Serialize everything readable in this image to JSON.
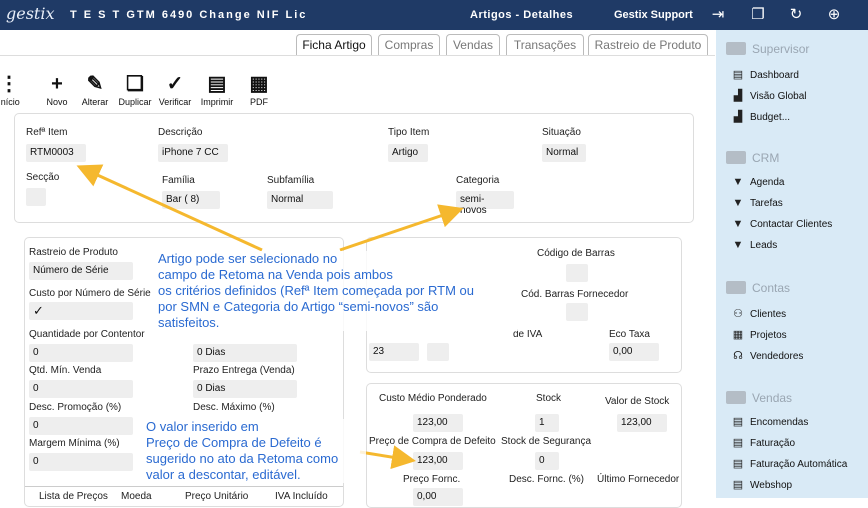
{
  "topbar": {
    "logo": "gestix",
    "app_title": "T E S T GTM 6490 Change NIF Lic",
    "page_title": "Artigos - Detalhes",
    "user": "Gestix Support",
    "icons": [
      "exit-icon",
      "windows-icon",
      "refresh-icon",
      "lifebuoy-icon"
    ]
  },
  "tabs": [
    "Ficha Artigo",
    "Compras",
    "Vendas",
    "Transações",
    "Rastreio de Produto"
  ],
  "toolbar": [
    {
      "label": "Início",
      "icon": "menu-icon"
    },
    {
      "label": "Novo",
      "icon": "plus-icon"
    },
    {
      "label": "Alterar",
      "icon": "edit-icon"
    },
    {
      "label": "Duplicar",
      "icon": "duplicate-icon"
    },
    {
      "label": "Verificar",
      "icon": "check-icon"
    },
    {
      "label": "Imprimir",
      "icon": "print-icon"
    },
    {
      "label": "PDF",
      "icon": "pdf-icon"
    }
  ],
  "header": {
    "ref_label": "Refª Item",
    "ref_value": "RTM0003",
    "desc_label": "Descrição",
    "desc_value": "iPhone 7 CC",
    "tipo_label": "Tipo Item",
    "tipo_value": "Artigo",
    "sit_label": "Situação",
    "sit_value": "Normal",
    "seccao_label": "Secção",
    "seccao_value": "",
    "familia_label": "Família",
    "familia_value": "Bar ( 8)",
    "subfamilia_label": "Subfamília",
    "subfamilia_value": "Normal",
    "categoria_label": "Categoria",
    "categoria_value": "semi-novos"
  },
  "left": {
    "rastreio_label": "Rastreio de Produto",
    "rastreio_value": "Número de Série",
    "custo_ns_label": "Custo por Número de Série",
    "custo_ns_value": "✓",
    "qtd_contentor_label": "Quantidade por Contentor",
    "qtd_contentor_value": "0",
    "dias1_value": "0 Dias",
    "qtd_min_label": "Qtd. Mín. Venda",
    "qtd_min_value": "0",
    "prazo_label": "Prazo Entrega (Venda)",
    "prazo_value": "0 Dias",
    "desc_promo_label": "Desc. Promoção (%)",
    "desc_promo_value": "0",
    "desc_max_label": "Desc. Máximo (%)",
    "margem_label": "Margem Mínima (%)",
    "margem_value": "0",
    "bottom_tabs": [
      "Lista de Preços",
      "Moeda",
      "Preço Unitário",
      "IVA Incluído"
    ]
  },
  "right": {
    "barcode_label": "Código de Barras",
    "barcode_forn_label": "Cód. Barras Fornecedor",
    "iva_label": "de IVA",
    "iva_value": "23",
    "eco_label": "Eco Taxa",
    "eco_value": "0,00",
    "custo_medio_label": "Custo Médio Ponderado",
    "custo_medio_value": "123,00",
    "stock_label": "Stock",
    "stock_value": "1",
    "valor_stock_label": "Valor de Stock",
    "valor_stock_value": "123,00",
    "preco_compra_label": "Preço de Compra de Defeito",
    "preco_compra_value": "123,00",
    "stock_seg_label": "Stock de Segurança",
    "stock_seg_value": "0",
    "preco_forn_label": "Preço Fornc.",
    "preco_forn_value": "0,00",
    "desc_forn_label": "Desc. Fornc. (%)",
    "ultimo_forn_label": "Último Fornecedor"
  },
  "annotations": {
    "note1": [
      "Artigo pode ser selecionado no",
      "campo de Retoma na Venda pois ambos",
      "os critérios definidos (Refª Item começada por RTM ou",
      "por SMN e Categoria do Artigo “semi-novos” são",
      "satisfeitos."
    ],
    "note2": [
      "O valor inserido em",
      "Preço de Compra de Defeito é",
      "sugerido no ato da Retoma como",
      "valor a descontar, editável."
    ],
    "arrow_color": "#f5b82e",
    "text_color": "#2a6ad1"
  },
  "sidebar": {
    "supervisor": {
      "title": "Supervisor",
      "items": [
        "Dashboard",
        "Visão Global",
        "Budget..."
      ]
    },
    "crm": {
      "title": "CRM",
      "items": [
        "Agenda",
        "Tarefas",
        "Contactar Clientes",
        "Leads"
      ]
    },
    "contas": {
      "title": "Contas",
      "items": [
        "Clientes",
        "Projetos",
        "Vendedores"
      ]
    },
    "vendas": {
      "title": "Vendas",
      "items": [
        "Encomendas",
        "Faturação",
        "Faturação Automática",
        "Webshop"
      ]
    }
  }
}
